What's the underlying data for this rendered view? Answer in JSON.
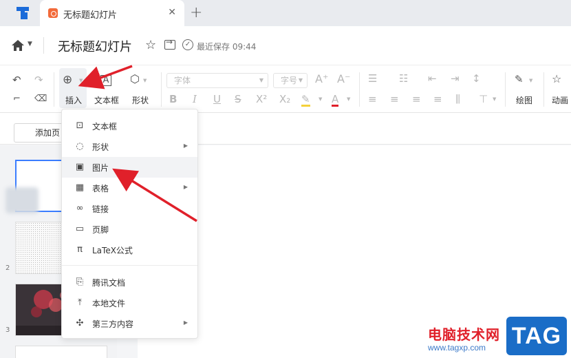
{
  "tabbar": {
    "tab_title": "无标题幻灯片",
    "close": "✕",
    "add": "+"
  },
  "titlebar": {
    "doc_title": "无标题幻灯片",
    "save_status": "最近保存 09:44"
  },
  "toolbar": {
    "insert_label": "插入",
    "textbox_label": "文本框",
    "shape_label": "形状",
    "font_placeholder": "字体",
    "size_placeholder": "字号",
    "draw_label": "绘图",
    "animation_label": "动画"
  },
  "subbar": {
    "add_page_label": "添加页"
  },
  "slides": [
    {
      "num": ""
    },
    {
      "num": "2"
    },
    {
      "num": "3"
    }
  ],
  "insert_menu": {
    "items": [
      {
        "label": "文本框"
      },
      {
        "label": "形状"
      },
      {
        "label": "图片"
      },
      {
        "label": "表格"
      },
      {
        "label": "链接"
      },
      {
        "label": "页脚"
      },
      {
        "label": "LaTeX公式"
      },
      {
        "label": "腾讯文档"
      },
      {
        "label": "本地文件"
      },
      {
        "label": "第三方内容"
      }
    ]
  },
  "watermark": {
    "site_name": "电脑技术网",
    "url": "www.tagxp.com",
    "tag": "TAG"
  },
  "colors": {
    "accent": "#3a7dff",
    "annotation_arrow": "#e0202a",
    "tab_icon": "#f26a3a"
  }
}
